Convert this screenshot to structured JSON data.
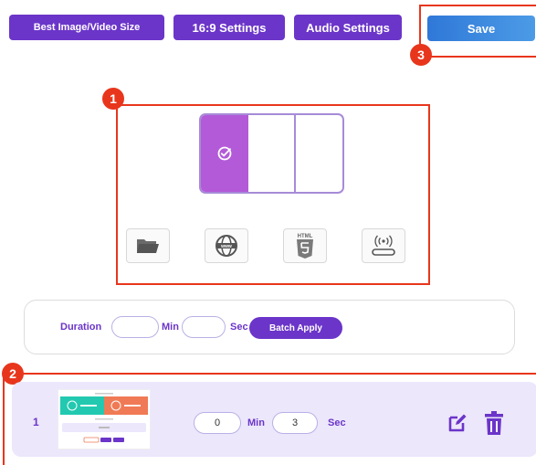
{
  "toolbar": {
    "best_size_label": "Best Image/Video Size",
    "ratio_settings_label": "16:9 Settings",
    "audio_settings_label": "Audio Settings",
    "save_label": "Save"
  },
  "callouts": {
    "one": "1",
    "two": "2",
    "three": "3"
  },
  "layout": {
    "selected_pane": 1,
    "pane_count": 3,
    "selected_color": "#b35ad8",
    "border_color": "#a78bd8"
  },
  "source_icons": [
    "folder-icon",
    "web-globe-icon",
    "html5-icon",
    "live-stream-icon"
  ],
  "html_icon_text": "HTML",
  "duration": {
    "label": "Duration",
    "min_label": "Min",
    "sec_label": "Sec",
    "min_value": "",
    "sec_value": "",
    "batch_label": "Batch Apply"
  },
  "items": [
    {
      "index": "1",
      "min_value": "0",
      "min_label": "Min",
      "sec_value": "3",
      "sec_label": "Sec"
    }
  ],
  "colors": {
    "primary": "#6b35c9",
    "save_blue": "#2f78d8",
    "callout_red": "#e8361c",
    "row_bg": "#ece7fb"
  }
}
